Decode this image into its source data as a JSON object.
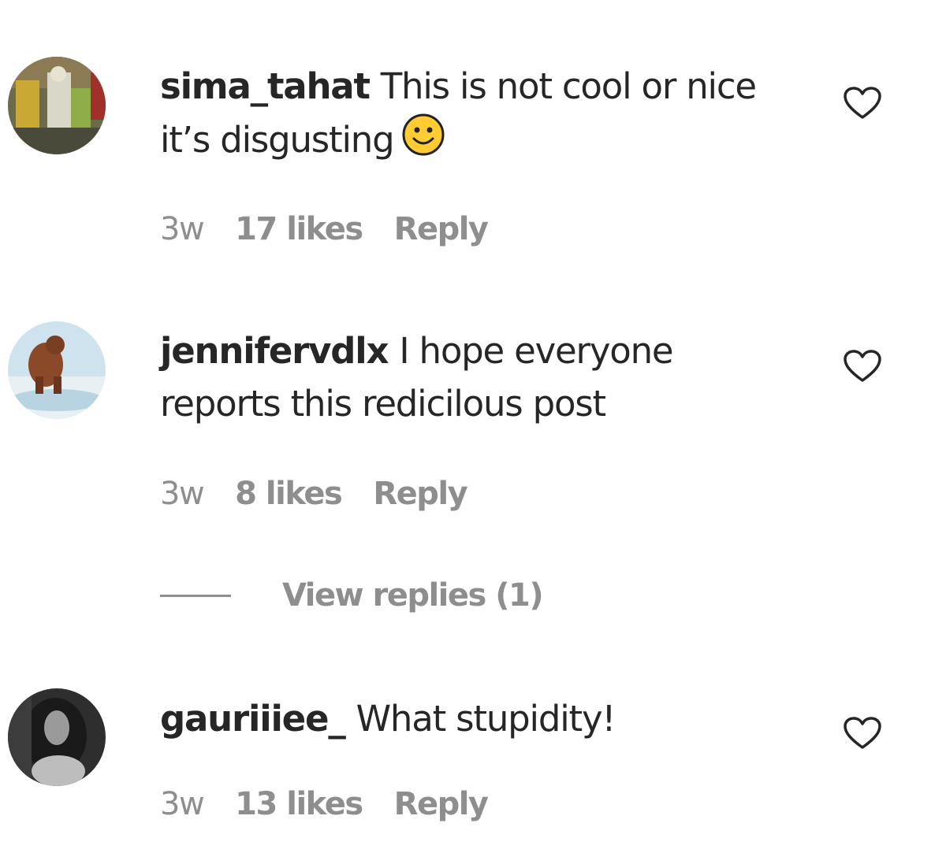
{
  "comments": [
    {
      "username": "sima_tahat",
      "text": "This is not cool or nice it’s disgusting",
      "emoji": "slightly-smiling-face-emoji",
      "age": "3w",
      "likes": "17 likes",
      "reply_label": "Reply"
    },
    {
      "username": "jennifervdlx",
      "text": "I hope everyone reports this redicilous post",
      "age": "3w",
      "likes": "8 likes",
      "reply_label": "Reply",
      "view_replies": "View replies (1)"
    },
    {
      "username": "gauriiiee_",
      "text": "What stupidity!",
      "age": "3w",
      "likes": "13 likes",
      "reply_label": "Reply"
    }
  ],
  "icons": {
    "like": "heart-outline-icon"
  },
  "colors": {
    "text": "#262626",
    "secondary": "#8e8e8e",
    "emoji_fill": "#ffcc33"
  }
}
